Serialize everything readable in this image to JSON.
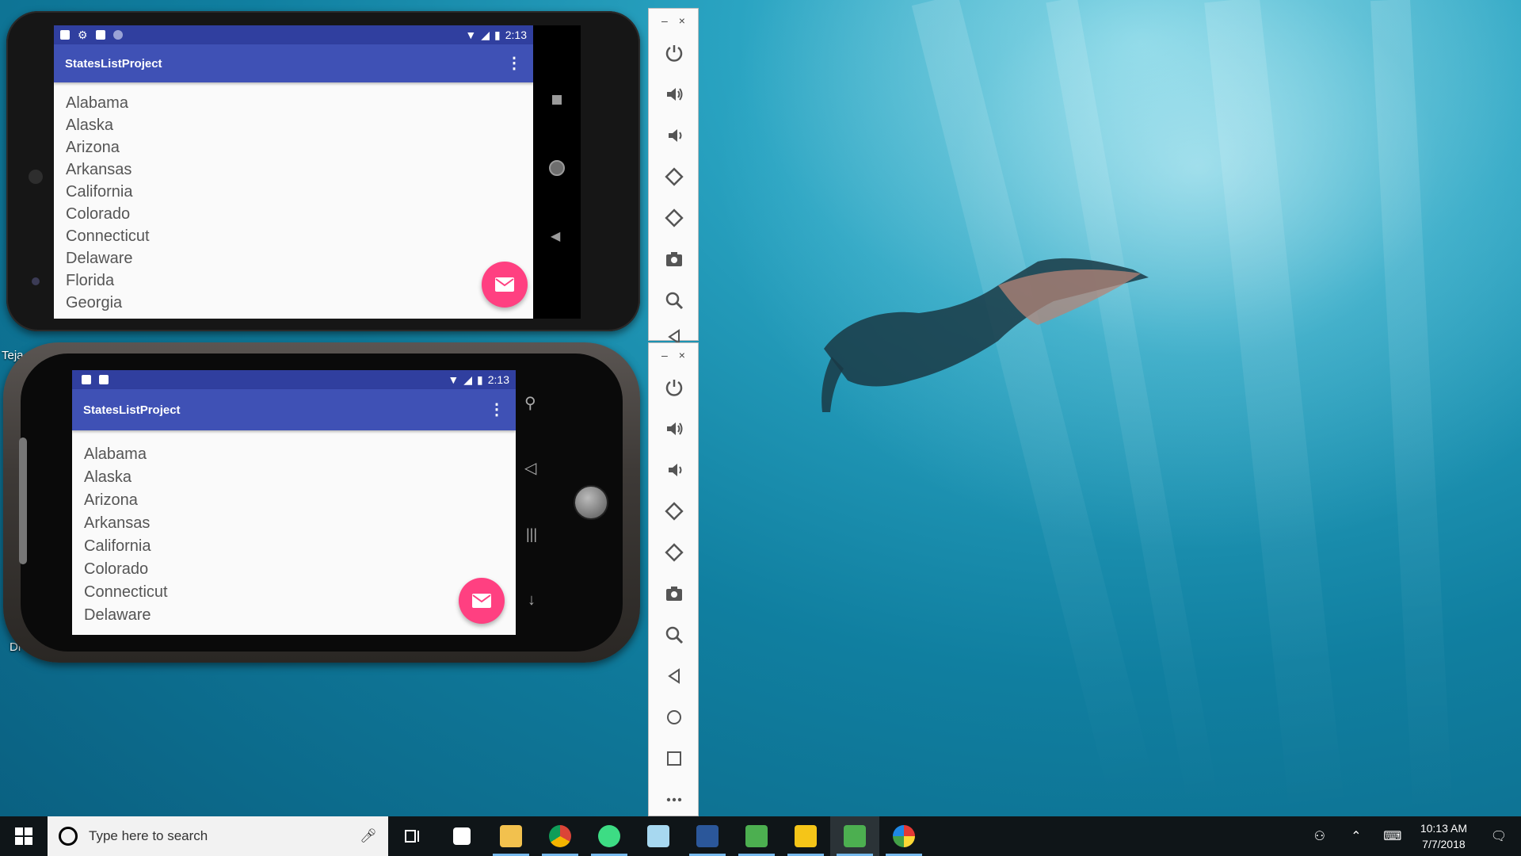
{
  "colors": {
    "primary": "#3f51b5",
    "primary_dark": "#303f9f",
    "accent": "#ff4081",
    "taskbar": "#0f1518"
  },
  "desktop": {
    "icon_labels": [
      "Teja",
      "Di"
    ]
  },
  "emulator_top": {
    "status_time": "2:13",
    "app_title": "StatesListProject",
    "states": [
      "Alabama",
      "Alaska",
      "Arizona",
      "Arkansas",
      "California",
      "Colorado",
      "Connecticut",
      "Delaware",
      "Florida",
      "Georgia"
    ],
    "status_icons": [
      "a-icon",
      "settings-icon",
      "sdcard-icon",
      "circle-icon"
    ],
    "nav_icons": [
      "square-icon",
      "home-circle-icon",
      "back-triangle-icon"
    ]
  },
  "emulator_bottom": {
    "status_time": "2:13",
    "app_title": "StatesListProject",
    "states": [
      "Alabama",
      "Alaska",
      "Arizona",
      "Arkansas",
      "California",
      "Colorado",
      "Connecticut",
      "Delaware"
    ],
    "status_icons": [
      "sdcard-icon",
      "a-icon"
    ],
    "hardware_icons": [
      "search-icon",
      "back-icon",
      "menu-icon",
      "down-arrow-icon"
    ]
  },
  "toolbar_top": {
    "window_controls": [
      "–",
      "×"
    ],
    "buttons": [
      "power-icon",
      "volume-up-icon",
      "volume-down-icon",
      "rotate-left-icon",
      "rotate-right-icon",
      "camera-icon",
      "zoom-icon",
      "back-icon"
    ]
  },
  "toolbar_bottom": {
    "window_controls": [
      "–",
      "×"
    ],
    "buttons": [
      "power-icon",
      "volume-up-icon",
      "volume-down-icon",
      "rotate-left-icon",
      "rotate-right-icon",
      "camera-icon",
      "zoom-icon",
      "back-icon",
      "home-icon",
      "overview-icon",
      "more-icon"
    ]
  },
  "taskbar": {
    "search_placeholder": "Type here to search",
    "apps": [
      "task-view-icon",
      "sticky-notes-icon",
      "file-explorer-icon",
      "chrome-icon",
      "android-studio-icon",
      "notepad-icon",
      "word-icon",
      "app-green-icon",
      "app-yellow-icon",
      "app-green2-icon",
      "paint-icon"
    ],
    "active_app_index": 9,
    "time": "10:13 AM",
    "date": "7/7/2018"
  }
}
